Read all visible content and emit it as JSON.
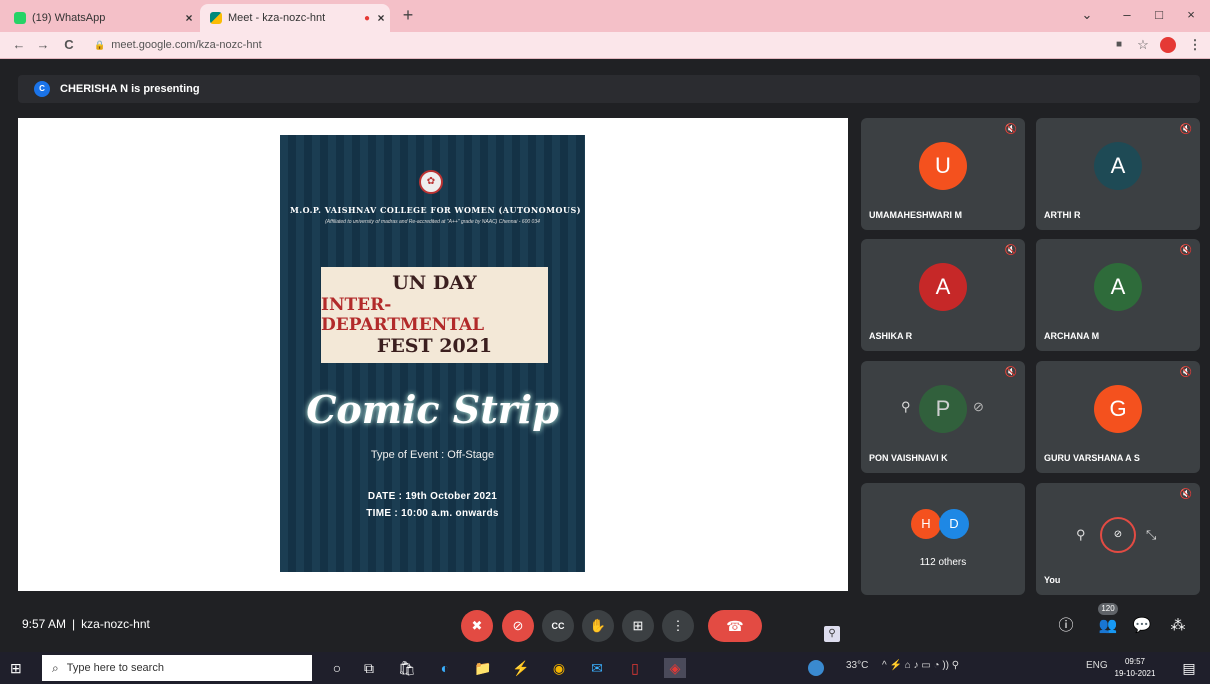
{
  "browser": {
    "tabs": [
      {
        "title": "(19) WhatsApp",
        "close": "×"
      },
      {
        "title": "Meet - kza-nozc-hnt",
        "close": "×",
        "recording_dot": "●"
      }
    ],
    "new_tab": "+",
    "window_controls": {
      "chevron": "⌄",
      "minimize": "–",
      "maximize": "□",
      "close": "×"
    },
    "nav": {
      "back": "←",
      "forward": "→",
      "reload": "C"
    },
    "url": "meet.google.com/kza-nozc-hnt",
    "toolbar_icons": {
      "camera": "■",
      "star": "☆",
      "menu": "⋮"
    },
    "colors": {
      "tabbar": "#f4c0c8",
      "active_tab": "#fbe6ea"
    }
  },
  "meet": {
    "presenter_initial": "C",
    "presenter_text": "CHERISHA N is presenting",
    "poster": {
      "emblem": "✿",
      "college": "M.O.P. VAISHNAV COLLEGE FOR WOMEN (AUTONOMOUS)",
      "affiliation": "(Affiliated to university of madras and Re-accredited at \"A++\" grade by NAAC) Chennai - 600 034",
      "banner_line1": "UN DAY",
      "banner_line2": "INTER-DEPARTMENTAL",
      "banner_line3": "FEST 2021",
      "event_name": "Comic Strip",
      "event_type": "Type of Event : Off-Stage",
      "date": "DATE : 19th October 2021",
      "time": "TIME : 10:00 a.m. onwards"
    },
    "participants": [
      {
        "initial": "U",
        "name": "UMAMAHESHWARI M",
        "color": "#f4511e",
        "muted": true
      },
      {
        "initial": "A",
        "name": "ARTHI R",
        "color": "#1e4a55",
        "muted": true
      },
      {
        "initial": "A",
        "name": "ASHIKA R",
        "color": "#c62828",
        "muted": true
      },
      {
        "initial": "A",
        "name": "ARCHANA M",
        "color": "#2e6b3a",
        "muted": true
      },
      {
        "initial": "P",
        "name": "PON VAISHNAVI K",
        "color": "#2e6b3a",
        "muted": true
      },
      {
        "initial": "G",
        "name": "GURU VARSHANA A S",
        "color": "#f4511e",
        "muted": true
      }
    ],
    "others": {
      "count_label": "112 others",
      "av1": "H",
      "av2": "D",
      "av1_color": "#f4511e",
      "av2_color": "#1e88e5"
    },
    "self": {
      "name": "You"
    },
    "meeting_time": "9:57 AM",
    "separator": "|",
    "meeting_code": "kza-nozc-hnt",
    "participant_count": "120",
    "icons": {
      "mute": "🎤",
      "pin": "⚲",
      "mic_off": "✖",
      "cam_off": "⊘",
      "captions": "CC",
      "raise_hand": "✋",
      "present": "⊞",
      "more": "⋮",
      "hangup": "☎",
      "info": "ⓘ",
      "people": "👥",
      "chat": "💬",
      "activities": "⁂",
      "fullscreen": "⤡",
      "muted": "🔇"
    }
  },
  "taskbar": {
    "start": "⊞",
    "search_placeholder": "Type here to search",
    "search_icon": "⌕",
    "temperature": "33°C",
    "language": "ENG",
    "clock_time": "09:57",
    "clock_date": "19-10-2021",
    "apps": {
      "cortana": "○",
      "taskview": "⧉",
      "store": "🛍",
      "edge": "◐",
      "files": "📁",
      "winamp": "⚡",
      "chrome": "◉",
      "mail": "✉",
      "office": "▯",
      "meet": "◈"
    },
    "tray_icons": "^ ⚡ ⌂ ♪ ▭ ◔ )) ⚲",
    "notification": "▤"
  }
}
